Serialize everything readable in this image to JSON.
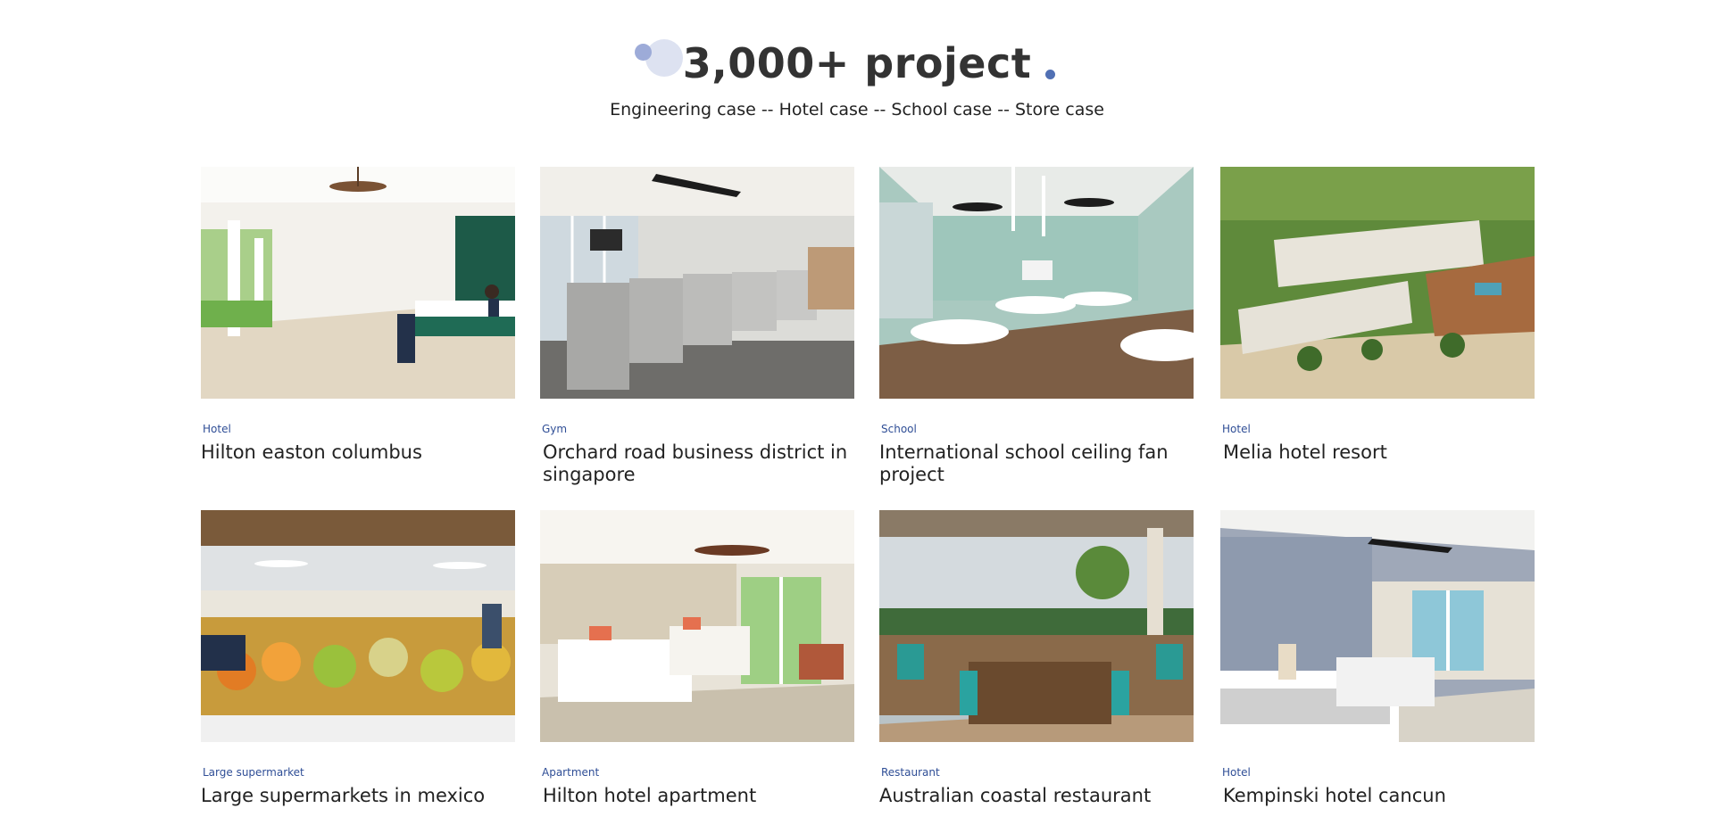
{
  "header": {
    "title": "3,000+ project",
    "subtitle": "Engineering case -- Hotel case -- School case -- Store case"
  },
  "colors": {
    "accent": "#2f4e96",
    "deco_light": "#dde2f1",
    "deco_mid": "#9dabd8",
    "deco_dark": "#5170b4"
  },
  "projects": [
    {
      "category": "Hotel",
      "title": "Hilton easton columbus",
      "image": "hotel-lobby-photo"
    },
    {
      "category": "Gym",
      "title": "Orchard road business district in singapore",
      "image": "gym-treadmills-photo"
    },
    {
      "category": "School",
      "title": "International school ceiling fan project",
      "image": "classroom-photo"
    },
    {
      "category": "Hotel",
      "title": "Melia hotel resort",
      "image": "resort-aerial-photo"
    },
    {
      "category": "Large supermarket",
      "title": "Large supermarkets in mexico",
      "image": "supermarket-produce-photo"
    },
    {
      "category": "Apartment",
      "title": "Hilton hotel apartment",
      "image": "apartment-bedroom-photo"
    },
    {
      "category": "Restaurant",
      "title": "Australian coastal restaurant",
      "image": "coastal-restaurant-photo"
    },
    {
      "category": "Hotel",
      "title": "Kempinski hotel cancun",
      "image": "hotel-bedroom-photo"
    }
  ]
}
